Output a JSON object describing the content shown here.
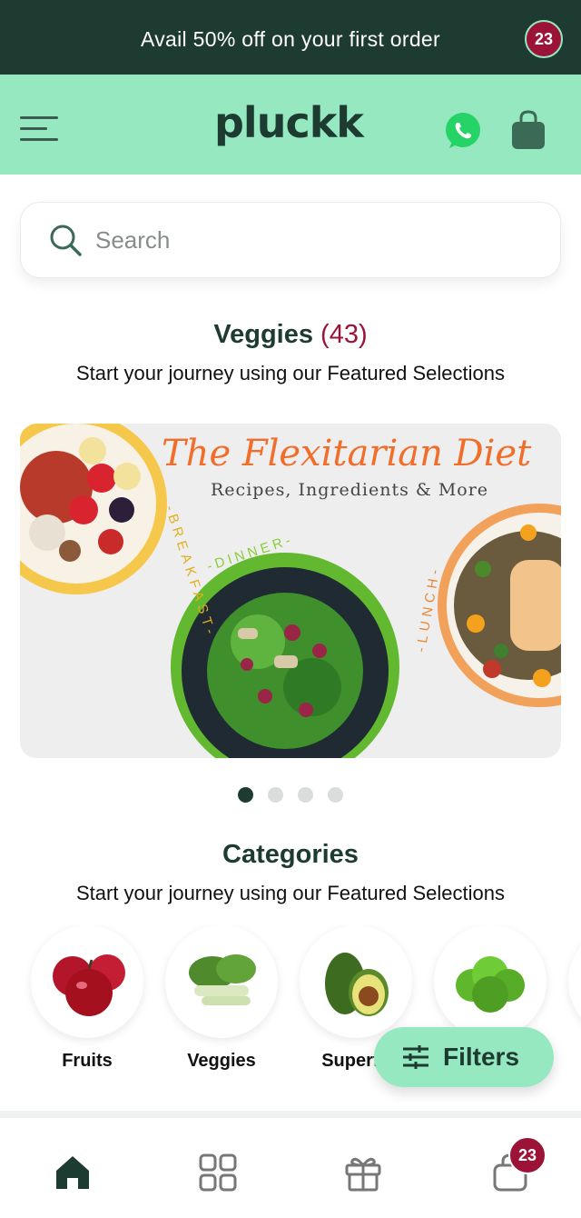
{
  "promo": {
    "text": "Avail 50% off on your first order"
  },
  "header": {
    "logo": "pluckk",
    "cart_count": "23"
  },
  "search": {
    "placeholder": "Search",
    "value": ""
  },
  "featured": {
    "title": "Veggies",
    "count": "(43)",
    "subtitle": "Start your journey using our Featured Selections"
  },
  "banner": {
    "title": "The Flexitarian Diet",
    "subtitle": "Recipes, Ingredients & More",
    "labels": {
      "breakfast": "-BREAKFAST-",
      "dinner": "-DINNER-",
      "lunch": "-LUNCH-"
    },
    "slide_count": 4,
    "active_slide": 1
  },
  "categories": {
    "title": "Categories",
    "subtitle": "Start your journey using our Featured Selections",
    "items": [
      {
        "label": "Fruits"
      },
      {
        "label": "Veggies"
      },
      {
        "label": "Superfo"
      }
    ]
  },
  "filters": {
    "label": "Filters"
  },
  "bottom_nav": {
    "cart_count": "23"
  },
  "colors": {
    "brand_dark": "#1d3b31",
    "brand_mint": "#95e8c0",
    "badge": "#9b1438",
    "accent_orange": "#f06e2a"
  },
  "icons": [
    "menu-icon",
    "whatsapp-icon",
    "bag-icon",
    "search-icon",
    "filter-icon",
    "home-icon",
    "grid-icon",
    "gift-icon"
  ]
}
